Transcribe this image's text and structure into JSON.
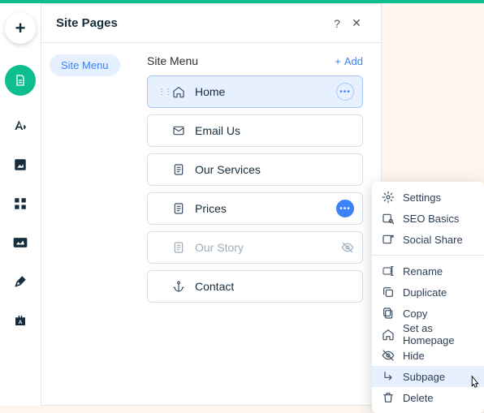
{
  "panel": {
    "title": "Site Pages",
    "help": "?",
    "close": "✕",
    "sidebar_tab": "Site Menu",
    "list_title": "Site Menu",
    "add_label": "Add"
  },
  "pages": [
    {
      "label": "Home",
      "icon": "home",
      "selected": true,
      "more": "ring"
    },
    {
      "label": "Email Us",
      "icon": "mail",
      "selected": false
    },
    {
      "label": "Our Services",
      "icon": "page",
      "selected": false
    },
    {
      "label": "Prices",
      "icon": "page",
      "selected": false,
      "more": "active"
    },
    {
      "label": "Our Story",
      "icon": "page",
      "selected": false,
      "disabled": true,
      "trailing": "hidden"
    },
    {
      "label": "Contact",
      "icon": "anchor",
      "selected": false
    }
  ],
  "context_menu": {
    "groups": [
      [
        {
          "label": "Settings",
          "icon": "gear"
        },
        {
          "label": "SEO Basics",
          "icon": "seo"
        },
        {
          "label": "Social Share",
          "icon": "share"
        }
      ],
      [
        {
          "label": "Rename",
          "icon": "rename"
        },
        {
          "label": "Duplicate",
          "icon": "duplicate"
        },
        {
          "label": "Copy",
          "icon": "copy"
        },
        {
          "label": "Set as Homepage",
          "icon": "home"
        },
        {
          "label": "Hide",
          "icon": "hide"
        },
        {
          "label": "Subpage",
          "icon": "subpage",
          "hover": true
        },
        {
          "label": "Delete",
          "icon": "delete"
        }
      ]
    ]
  }
}
